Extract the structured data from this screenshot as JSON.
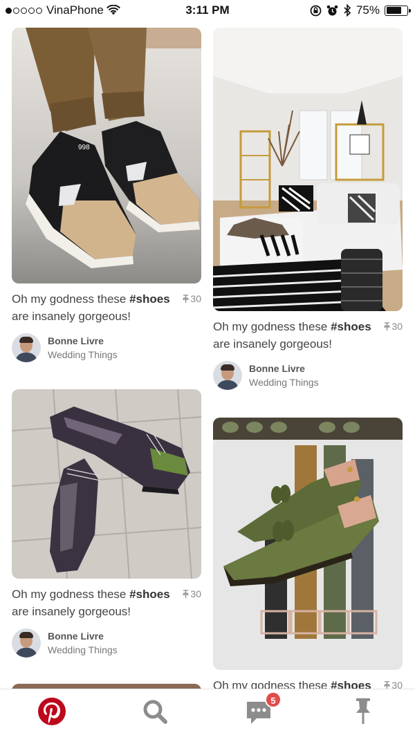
{
  "status_bar": {
    "carrier": "VinaPhone",
    "time": "3:11 PM",
    "battery": "75%",
    "battery_level": 0.75
  },
  "feed": {
    "pins": [
      {
        "caption_prefix": "Oh my godness these ",
        "caption_tag": "#shoes",
        "caption_suffix": "are insanely gorgeous!",
        "saves": "30",
        "author_name": "Bonne Livre",
        "board": "Wedding Things",
        "image": "New Balance 998 sneakers"
      },
      {
        "caption_prefix": "Oh my godness these ",
        "caption_tag": "#shoes",
        "caption_suffix": "are insanely gorgeous!",
        "saves": "30",
        "author_name": "Bonne Livre",
        "board": "Wedding Things",
        "image": "living room interior"
      },
      {
        "caption_prefix": "Oh my godness these ",
        "caption_tag": "#shoes",
        "caption_suffix": "are insanely gorgeous!",
        "saves": "30",
        "author_name": "Bonne Livre",
        "board": "Wedding Things",
        "image": "purple brogue shoes"
      },
      {
        "caption_prefix": "Oh my godness these ",
        "caption_tag": "#shoes",
        "saves": "30",
        "image": "green suede loafers and belts"
      }
    ]
  },
  "tab_bar": {
    "home_icon": "pinterest-logo",
    "search_icon": "search-icon",
    "messages_icon": "chat-icon",
    "messages_badge": "5",
    "profile_icon": "pin-icon",
    "accent": "#bd081c",
    "inactive": "#999999"
  }
}
